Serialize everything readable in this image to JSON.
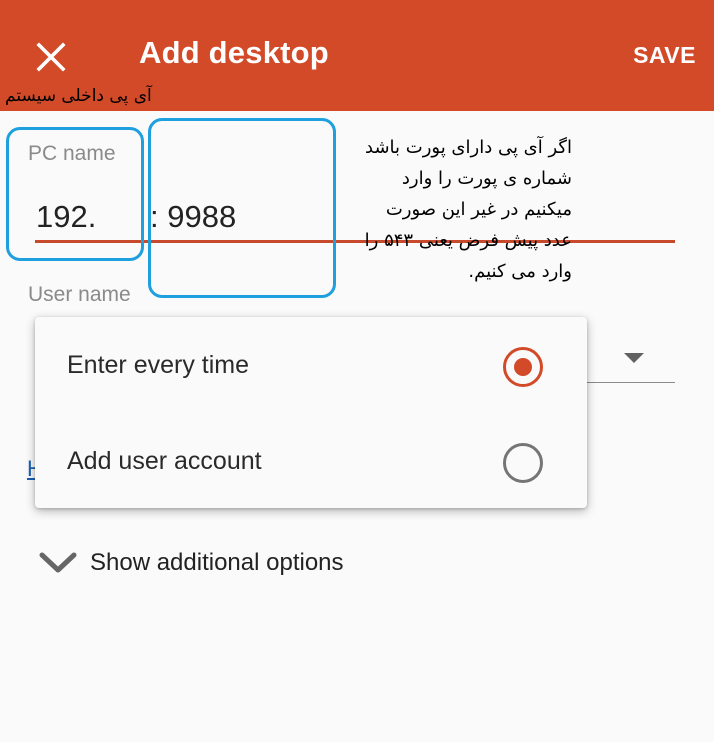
{
  "appbar": {
    "title": "Add desktop",
    "save_label": "SAVE",
    "close_icon": "close-icon",
    "background": "#d24a28"
  },
  "annotations": {
    "top_left": "آی پی داخلی سیستم",
    "right_lines": [
      "اگر آی پی دارای پورت باشد",
      "شماره ی پورت را وارد",
      "میکنیم در غیر این صورت",
      "عدد پیش فرض یعنی ۵۴۳ را",
      "وارد می کنیم."
    ],
    "box_color": "#1fa0de"
  },
  "form": {
    "pc_name_label": "PC name",
    "pc_name_value": "192.",
    "port_value": ": 9988",
    "user_name_label": "User name",
    "help_link_fragment": "H",
    "more_options_label": "Show additional options"
  },
  "user_menu": {
    "options": [
      {
        "label": "Enter every time",
        "selected": true
      },
      {
        "label": "Add user account",
        "selected": false
      }
    ],
    "accent": "#d24a28"
  }
}
